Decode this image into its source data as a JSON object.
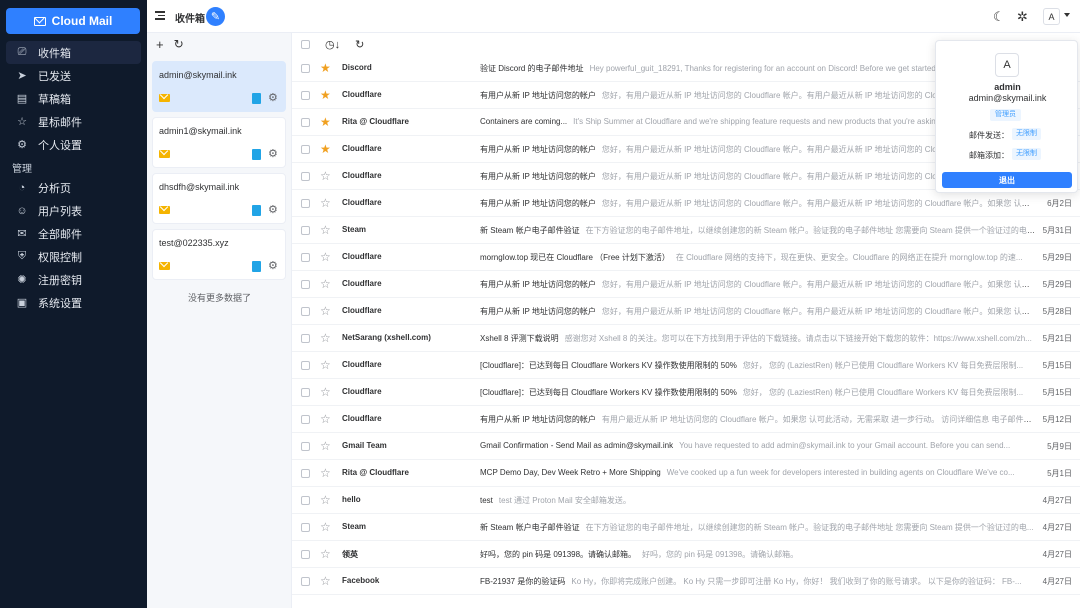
{
  "sidebar": {
    "brand": "Cloud Mail",
    "items": [
      {
        "label": "收件箱",
        "icon": "inbox-icon",
        "glyph": "⎚"
      },
      {
        "label": "已发送",
        "icon": "send-icon",
        "glyph": "➤"
      },
      {
        "label": "草稿箱",
        "icon": "draft-icon",
        "glyph": "▤"
      },
      {
        "label": "星标邮件",
        "icon": "star-icon",
        "glyph": "☆"
      },
      {
        "label": "个人设置",
        "icon": "settings-icon",
        "glyph": "⚙"
      }
    ],
    "section_label": "管理",
    "admin_items": [
      {
        "label": "分析页",
        "icon": "analytics-icon",
        "glyph": "◔"
      },
      {
        "label": "用户列表",
        "icon": "user-icon",
        "glyph": "☺"
      },
      {
        "label": "全部邮件",
        "icon": "all-mail-icon",
        "glyph": "✉"
      },
      {
        "label": "权限控制",
        "icon": "permission-icon",
        "glyph": "⛨"
      },
      {
        "label": "注册密钥",
        "icon": "key-icon",
        "glyph": "✺"
      },
      {
        "label": "系统设置",
        "icon": "system-icon",
        "glyph": "▣"
      }
    ]
  },
  "header": {
    "title": "收件箱",
    "avatar": "A"
  },
  "accounts": {
    "items": [
      {
        "email": "admin@skymail.ink"
      },
      {
        "email": "admin1@skymail.ink"
      },
      {
        "email": "dhsdfh@skymail.ink"
      },
      {
        "email": "test@022335.xyz"
      }
    ],
    "no_more": "没有更多数据了"
  },
  "mails": [
    {
      "sender": "Discord",
      "subject": "验证 Discord 的电子邮件地址",
      "preview": "Hey powerful_guit_18291, Thanks for registering for an account on Discord! Before we get started, we just need to confirm",
      "date": "",
      "starred": true
    },
    {
      "sender": "Cloudflare",
      "subject": "有用户从新 IP 地址访问您的帐户",
      "preview": "您好，有用户最近从新 IP 地址访问您的 Cloudflare 帐户。有用户最近从新 IP 地址访问您的 Cloudflare 帐户。",
      "date": "",
      "starred": true
    },
    {
      "sender": "Rita @ Cloudflare",
      "subject": "Containers are coming...",
      "preview": "It's Ship Summer at Cloudflare and we're shipping feature requests and new products that you're asking for",
      "date": "",
      "starred": true
    },
    {
      "sender": "Cloudflare",
      "subject": "有用户从新 IP 地址访问您的帐户",
      "preview": "您好，有用户最近从新 IP 地址访问您的 Cloudflare 帐户。有用户最近从新 IP 地址访问您的 Cloudflare 帐户。",
      "date": "",
      "starred": true
    },
    {
      "sender": "Cloudflare",
      "subject": "有用户从新 IP 地址访问您的帐户",
      "preview": "您好，有用户最近从新 IP 地址访问您的 Cloudflare 帐户。有用户最近从新 IP 地址访问您的 Cloudflare 帐户。",
      "date": "",
      "starred": false
    },
    {
      "sender": "Cloudflare",
      "subject": "有用户从新 IP 地址访问您的帐户",
      "preview": "您好，有用户最近从新 IP 地址访问您的 Cloudflare 帐户。有用户最近从新 IP 地址访问您的 Cloudflare 帐户。如果您 认可此活动...",
      "date": "6月2日",
      "starred": false
    },
    {
      "sender": "Steam",
      "subject": "新 Steam 帐户电子邮件验证",
      "preview": "在下方验证您的电子邮件地址，以继续创建您的新 Steam 帐户。验证我的电子邮件地址 您需要向 Steam 提供一个验证过的电子...",
      "date": "5月31日",
      "starred": false
    },
    {
      "sender": "Cloudflare",
      "subject": "morngIow.top 现已在 Cloudflare （Free 计划下激活）",
      "preview": "在 Cloudflare 网络的支持下，现在更快、更安全。Cloudflare 的网络正在提升 morngIow.top 的速...",
      "date": "5月29日",
      "starred": false
    },
    {
      "sender": "Cloudflare",
      "subject": "有用户从新 IP 地址访问您的帐户",
      "preview": "您好，有用户最近从新 IP 地址访问您的 Cloudflare 帐户。有用户最近从新 IP 地址访问您的 Cloudflare 帐户。如果您 认可此活...",
      "date": "5月29日",
      "starred": false
    },
    {
      "sender": "Cloudflare",
      "subject": "有用户从新 IP 地址访问您的帐户",
      "preview": "您好，有用户最近从新 IP 地址访问您的 Cloudflare 帐户。有用户最近从新 IP 地址访问您的 Cloudflare 帐户。如果您 认可此活...",
      "date": "5月28日",
      "starred": false
    },
    {
      "sender": "NetSarang (xshell.com)",
      "subject": "Xshell 8 评测下载说明",
      "preview": "感谢您对 Xshell 8 的关注。您可以在下方找到用于评估的下载链接。请点击以下链接开始下载您的软件：https://www.xshell.com/zh...",
      "date": "5月21日",
      "starred": false
    },
    {
      "sender": "Cloudflare",
      "subject": "[Cloudflare]：已达到每日 Cloudflare Workers KV 操作数使用限制的 50%",
      "preview": "您好， 您的 (LaziestRen) 帐户已使用 Cloudflare Workers KV 每日免费层限制...",
      "date": "5月15日",
      "starred": false
    },
    {
      "sender": "Cloudflare",
      "subject": "[Cloudflare]：已达到每日 Cloudflare Workers KV 操作数使用限制的 50%",
      "preview": "您好， 您的 (LaziestRen) 帐户已使用 Cloudflare Workers KV 每日免费层限制...",
      "date": "5月15日",
      "starred": false
    },
    {
      "sender": "Cloudflare",
      "subject": "有用户从新 IP 地址访问您的帐户",
      "preview": "有用户最近从新 IP 地址访问您的 Cloudflare 帐户。如果您 认可此活动，无需采取 进一步行动。 访问详细信息 电子邮件：...",
      "date": "5月12日",
      "starred": false
    },
    {
      "sender": "Gmail Team",
      "subject": "Gmail Confirmation - Send Mail as admin@skymail.ink",
      "preview": "You have requested to add admin@skymail.ink to your Gmail account. Before you can send...",
      "date": "5月9日",
      "starred": false
    },
    {
      "sender": "Rita @ Cloudflare",
      "subject": "MCP Demo Day, Dev Week Retro + More Shipping",
      "preview": "We've cooked up a fun week for developers interested in building agents on Cloudflare We've co...",
      "date": "5月1日",
      "starred": false
    },
    {
      "sender": "hello",
      "subject": "test",
      "preview": "test 通过 Proton Mail 安全邮箱发送。",
      "date": "4月27日",
      "starred": false
    },
    {
      "sender": "Steam",
      "subject": "新 Steam 帐户电子邮件验证",
      "preview": "在下方验证您的电子邮件地址，以继续创建您的新 Steam 帐户。验证我的电子邮件地址 您需要向 Steam 提供一个验证过的电...",
      "date": "4月27日",
      "starred": false
    },
    {
      "sender": "领英",
      "subject": "好吗，您的 pin 码是 091398。请确认邮箱。",
      "preview": "好吗，您的 pin 码是 091398。请确认邮箱。",
      "date": "4月27日",
      "starred": false
    },
    {
      "sender": "Facebook",
      "subject": "FB-21937 是你的验证码",
      "preview": "Ko Hy，你即将完成账户创建。 Ko Hy 只需一步即可注册 Ko Hy，你好！ 我们收到了你的账号请求。 以下是你的验证码： FB-...",
      "date": "4月27日",
      "starred": false
    }
  ],
  "popover": {
    "avatar": "A",
    "name": "admin",
    "email": "admin@skymail.ink",
    "role": "管理员",
    "send_label": "邮件发送：",
    "send_value": "无限制",
    "add_label": "邮箱添加：",
    "add_value": "无限制",
    "logout": "退出"
  },
  "colors": {
    "accent": "#2f80ff",
    "sidebar_bg": "#0f1a2b",
    "star_on": "#f0a020"
  }
}
